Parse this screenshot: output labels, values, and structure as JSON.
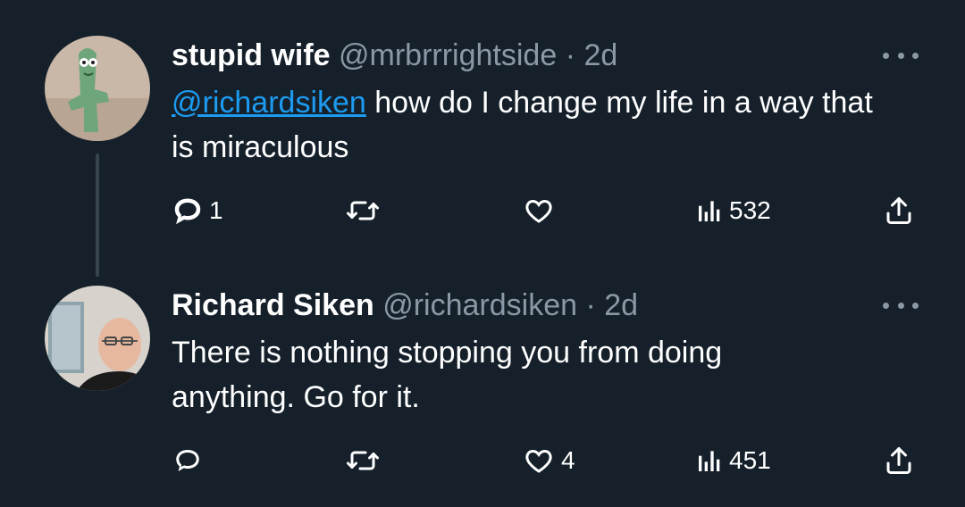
{
  "tweets": [
    {
      "author_name": "stupid wife",
      "handle": "@mrbrrrightside",
      "separator": "·",
      "time": "2d",
      "mention": "@richardsiken",
      "text": " how do I change my life in a way that is miraculous",
      "replies": "1",
      "retweets": "",
      "likes": "",
      "views": "532",
      "avatar_icon": "gumby-avatar"
    },
    {
      "author_name": "Richard Siken",
      "handle": "@richardsiken",
      "separator": "·",
      "time": "2d",
      "text": "There is nothing stopping you from doing anything. Go for it.",
      "replies": "",
      "retweets": "",
      "likes": "4",
      "views": "451",
      "avatar_icon": "person-avatar"
    }
  ],
  "colors": {
    "background": "#15202b",
    "text": "#ffffff",
    "muted": "#8b98a5",
    "link": "#1d9bf0",
    "thread_line": "#38444d"
  }
}
